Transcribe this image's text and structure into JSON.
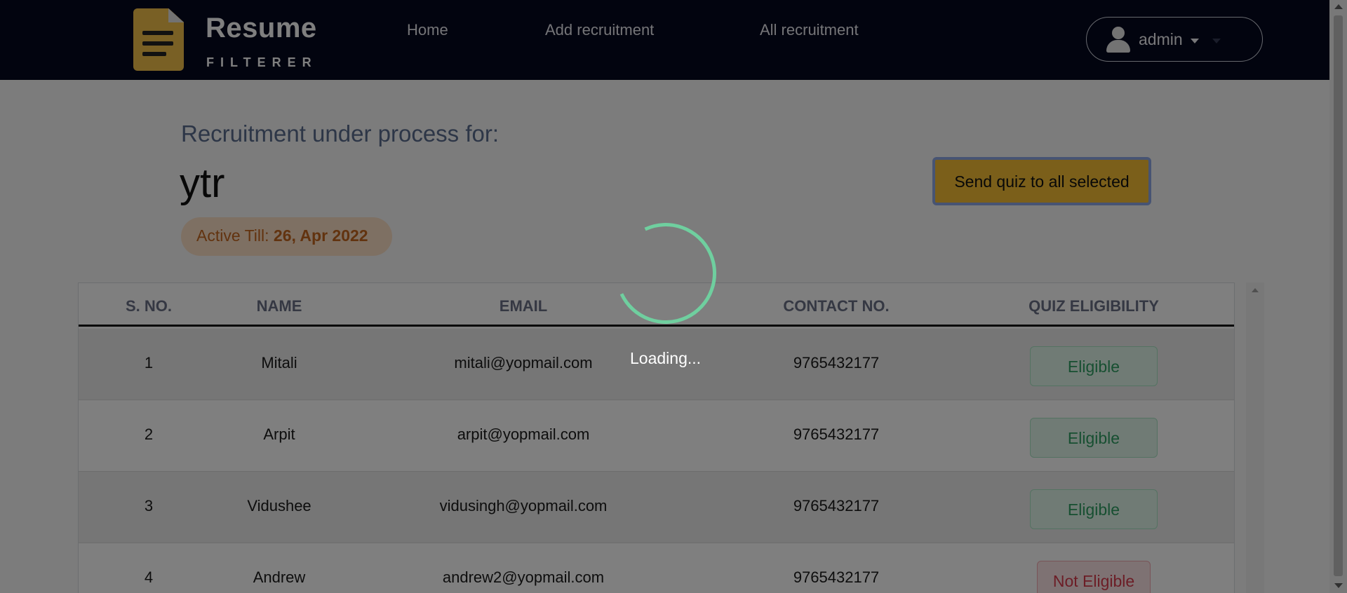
{
  "brand": {
    "word1": "Resume",
    "word2": "FILTERER"
  },
  "nav": {
    "links": [
      "Home",
      "Add recruitment",
      "All recruitment"
    ],
    "user": "admin"
  },
  "main": {
    "subheading": "Recruitment under process for:",
    "recruitment_title": "ytr",
    "active_label": "Active Till:",
    "active_date": "26, Apr 2022",
    "send_quiz_label": "Send quiz to all selected"
  },
  "table": {
    "headers": [
      "S. NO.",
      "NAME",
      "EMAIL",
      "CONTACT NO.",
      "QUIZ ELIGIBILITY"
    ],
    "rows": [
      {
        "sno": "1",
        "name": "Mitali",
        "email": "mitali@yopmail.com",
        "contact": "9765432177",
        "eligibility": "Eligible"
      },
      {
        "sno": "2",
        "name": "Arpit",
        "email": "arpit@yopmail.com",
        "contact": "9765432177",
        "eligibility": "Eligible"
      },
      {
        "sno": "3",
        "name": "Vidushee",
        "email": "vidusingh@yopmail.com",
        "contact": "9765432177",
        "eligibility": "Eligible"
      },
      {
        "sno": "4",
        "name": "Andrew",
        "email": "andrew2@yopmail.com",
        "contact": "9765432177",
        "eligibility": "Not Eligible"
      }
    ]
  },
  "loading": {
    "text": "Loading..."
  },
  "colors": {
    "navbar": "#04081f",
    "accent_button": "#f6bf35",
    "eligible": "#2e9e63",
    "not_eligible": "#d93b4d",
    "spinner": "#6fcf9f"
  }
}
